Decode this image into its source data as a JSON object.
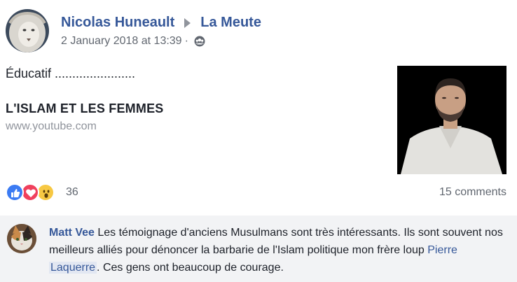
{
  "post": {
    "author": "Nicolas Huneault",
    "group": "La Meute",
    "timestamp": "2 January 2018 at 13:39",
    "separator": "·",
    "audience_icon": "group-audience-icon",
    "text": "Éducatif .......................",
    "link": {
      "title": "L'ISLAM ET LES FEMMES",
      "domain": "www.youtube.com"
    }
  },
  "reactions": {
    "count": "36",
    "icons": [
      "like-icon",
      "love-icon",
      "wow-icon"
    ],
    "comments": "15 comments"
  },
  "comment": {
    "author": "Matt Vee",
    "text_1": " Les témoignage d'anciens Musulmans sont très intéressants. Ils sont souvent nos meilleurs alliés pour dénoncer la barbarie de l'Islam politique mon frère loup ",
    "mention_1": "Pierre",
    "space": " ",
    "mention_2": "Laquerre",
    "text_2": ". Ces gens ont beaucoup de courage."
  },
  "colors": {
    "link_blue": "#365899",
    "meta_gray": "#616770",
    "comment_bg": "#f2f3f5"
  }
}
